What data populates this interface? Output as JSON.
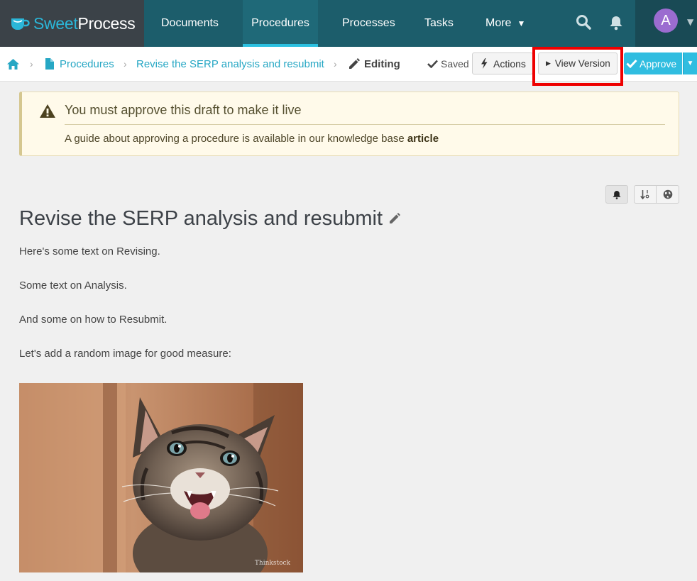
{
  "brand": {
    "sweet": "Sweet",
    "process": "Process"
  },
  "nav": {
    "documents": "Documents",
    "procedures": "Procedures",
    "processes": "Processes",
    "tasks": "Tasks",
    "more": "More"
  },
  "user": {
    "initial": "A"
  },
  "breadcrumb": {
    "procedures": "Procedures",
    "item": "Revise the SERP analysis and resubmit",
    "editing": "Editing"
  },
  "toolbar": {
    "saved": "Saved",
    "actions": "Actions",
    "view_version": "View Version",
    "approve": "Approve"
  },
  "alert": {
    "title": "You must approve this draft to make it live",
    "text": "A guide about approving a procedure is available in our knowledge base",
    "link": "article"
  },
  "procedure": {
    "title": "Revise the SERP analysis and resubmit",
    "paragraphs": [
      "Here's some text on Revising.",
      "Some text on Analysis.",
      "And some on how to Resubmit.",
      "Let's add a random image for good measure:"
    ],
    "image_credit": "Thinkstock"
  },
  "colors": {
    "nav_bg": "#1c5d6b",
    "brand_bg": "#3b4248",
    "accent": "#30bde0",
    "link": "#26a7c4",
    "highlight": "#ee0000",
    "alert_bg": "#fffaea"
  }
}
